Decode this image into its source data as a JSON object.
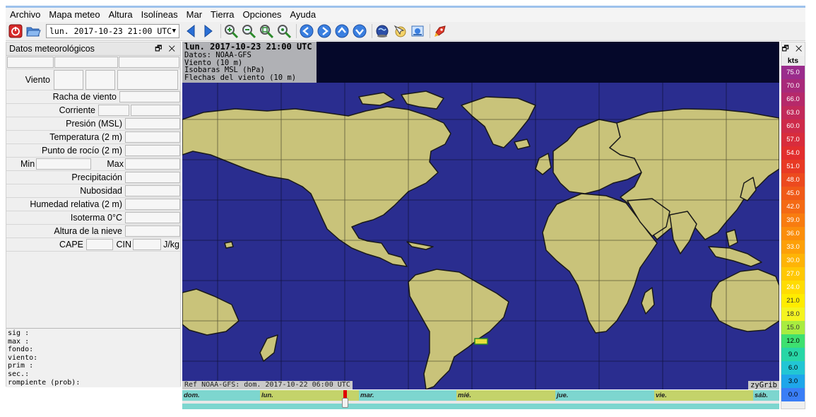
{
  "menu": [
    "Archivo",
    "Mapa meteo",
    "Altura",
    "Isolíneas",
    "Mar",
    "Tierra",
    "Opciones",
    "Ayuda"
  ],
  "toolbar": {
    "date_value": "lun. 2017-10-23 21:00 UTC",
    "buttons": [
      "power-icon",
      "folder-open-icon",
      "arrow-left-icon",
      "arrow-right-icon",
      "zoom-in-icon",
      "zoom-out-icon",
      "zoom-fit-icon",
      "zoom-reset-icon",
      "pan-left-icon",
      "pan-right-icon",
      "pan-up-icon",
      "pan-down-icon",
      "globe-icon",
      "cursor-icon",
      "export-icon",
      "rocket-icon"
    ]
  },
  "panel": {
    "title": "Datos meteorológicos",
    "controls": "🗗 ✕",
    "wind_label": "Viento",
    "gust_label": "Racha de viento",
    "current_label": "Corriente",
    "pressure_label": "Presión (MSL)",
    "temperature_label": "Temperatura (2 m)",
    "dewpoint_label": "Punto de rocío (2 m)",
    "min_label": "Min",
    "max_label": "Max",
    "precip_label": "Precipitación",
    "cloud_label": "Nubosidad",
    "humidity_label": "Humedad relativa (2 m)",
    "isotherm_label": "Isoterma 0°C",
    "snow_label": "Altura de la nieve",
    "cape_label": "CAPE",
    "cin_label": "CIN",
    "jkg_label": "J/kg",
    "notes": [
      "sig :",
      "max  :",
      "fondo:",
      "viento:",
      "prim :",
      "sec.:",
      "rompiente (prob):"
    ]
  },
  "map": {
    "info_line1": "lun. 2017-10-23 21:00 UTC",
    "info_line2": "Datos: NOAA-GFS",
    "info_line3": "Viento (10 m)",
    "info_line4": "Isobaras MSL (hPa)",
    "info_line5": "Flechas del viento (10 m)",
    "ref": "Ref NOAA-GFS: dom. 2017-10-22 06:00 UTC",
    "brand": "zyGrib",
    "colors": {
      "ocean": "#2a2d8f",
      "land": "#c9c37a",
      "coast": "#1a1a1a",
      "grid": "#000000"
    }
  },
  "timeline": {
    "days": [
      "dom.",
      "lun.",
      "mar.",
      "mié.",
      "jue.",
      "vie.",
      "sáb."
    ],
    "colors": [
      "#7dd6cf",
      "#c4d36a"
    ]
  },
  "legend": {
    "controls": "🗗 ✕",
    "unit": "kts",
    "scale": [
      {
        "v": "75.0",
        "c": "#9a2c8c"
      },
      {
        "v": "70.0",
        "c": "#a82a7a"
      },
      {
        "v": "66.0",
        "c": "#b6296a"
      },
      {
        "v": "63.0",
        "c": "#c22a5a"
      },
      {
        "v": "60.0",
        "c": "#ce2b4a"
      },
      {
        "v": "57.0",
        "c": "#d82c3c"
      },
      {
        "v": "54.0",
        "c": "#e22e2e"
      },
      {
        "v": "51.0",
        "c": "#e83a24"
      },
      {
        "v": "48.0",
        "c": "#ec4a1e"
      },
      {
        "v": "45.0",
        "c": "#f05a18"
      },
      {
        "v": "42.0",
        "c": "#f46a14"
      },
      {
        "v": "39.0",
        "c": "#f87c10"
      },
      {
        "v": "36.0",
        "c": "#fb8e0c"
      },
      {
        "v": "33.0",
        "c": "#fda008"
      },
      {
        "v": "30.0",
        "c": "#feb406"
      },
      {
        "v": "27.0",
        "c": "#ffc804"
      },
      {
        "v": "24.0",
        "c": "#ffdc02"
      },
      {
        "v": "21.0",
        "c": "#ffec00"
      },
      {
        "v": "18.0",
        "c": "#f4f420"
      },
      {
        "v": "15.0",
        "c": "#a8ec40"
      },
      {
        "v": "12.0",
        "c": "#3ee070"
      },
      {
        "v": "9.0",
        "c": "#28d6a6"
      },
      {
        "v": "6.0",
        "c": "#22c6d4"
      },
      {
        "v": "3.0",
        "c": "#1ea6ea"
      },
      {
        "v": "0.0",
        "c": "#3a7ef6"
      }
    ]
  }
}
